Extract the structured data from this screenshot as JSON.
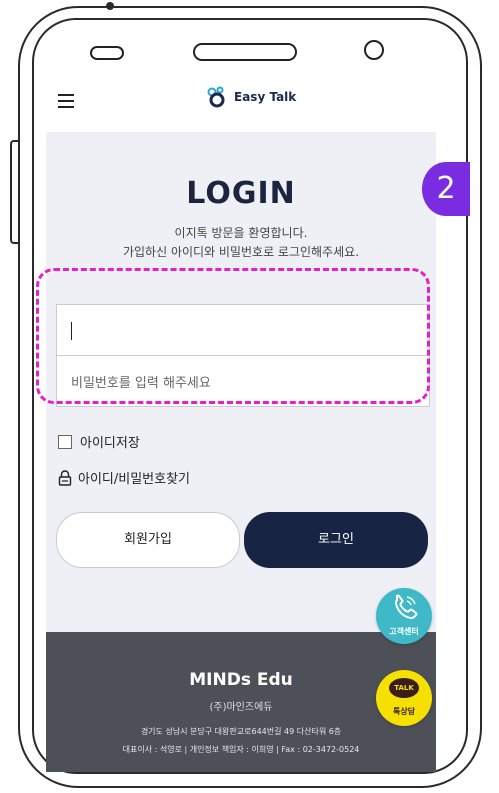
{
  "header": {
    "brand": "Easy Talk"
  },
  "login": {
    "title": "LOGIN",
    "welcome_line1": "이지톡 방문을 환영합니다.",
    "welcome_line2": "가입하신 아이디와 비밀번호로 로그인해주세요.",
    "id_value": "",
    "password_placeholder": "비밀번호를 입력 해주세요",
    "remember_label": "아이디저장",
    "remember_checked": false,
    "find_label": "아이디/비밀번호찾기",
    "join_label": "회원가입",
    "login_label": "로그인"
  },
  "footer": {
    "brand": "MINDs Edu",
    "company": "(주)마인즈에듀",
    "address": "경기도 성남시 분당구 대왕판교로644번길 49 다산타워 6층",
    "ceo_line": "대표이사 : 석영로 | 개인정보 책임자 : 이희영 | Fax : 02-3472-0524"
  },
  "floating": {
    "cs_label": "고객센터",
    "talk_bubble": "TALK",
    "talk_label": "톡상담"
  },
  "annotation": {
    "step": "2"
  },
  "colors": {
    "primary_navy": "#172443",
    "page_bg": "#eef0f5",
    "footer_bg": "#4d5057",
    "cs_teal": "#3fb8c8",
    "talk_yellow": "#f6e000",
    "step_purple": "#7a2de0",
    "highlight_magenta": "#e61ecc"
  }
}
